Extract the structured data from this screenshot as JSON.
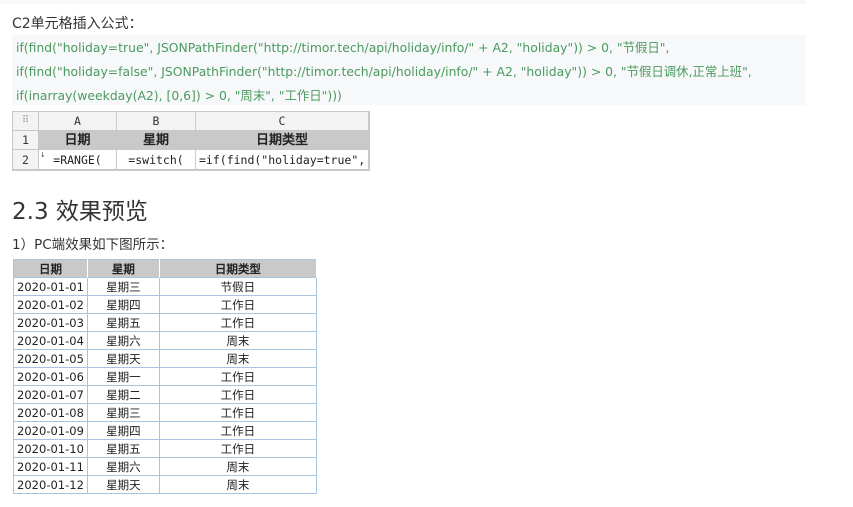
{
  "intro_text": "C2单元格插入公式：",
  "code_lines": [
    "if(find(\"holiday=true\", JSONPathFinder(\"http://timor.tech/api/holiday/info/\" + A2, \"holiday\")) > 0, \"节假日\",",
    "if(find(\"holiday=false\", JSONPathFinder(\"http://timor.tech/api/holiday/info/\" + A2, \"holiday\")) > 0, \"节假日调休,正常上班\",",
    "if(inarray(weekday(A2), [0,6]) > 0, \"周末\", \"工作日\")))"
  ],
  "designer": {
    "corner_icon": "grid-handle-icon",
    "columns": [
      "A",
      "B",
      "C"
    ],
    "rows": [
      {
        "num": "1",
        "cells": [
          "日期",
          "星期",
          "日期类型"
        ]
      },
      {
        "num": "2",
        "cells": [
          "=RANGE(",
          "=switch(",
          "=if(find(\"holiday=true\","
        ]
      }
    ]
  },
  "section_heading": "2.3 效果预览",
  "section_sub": "1）PC端效果如下图所示：",
  "result_table": {
    "headers": [
      "日期",
      "星期",
      "日期类型"
    ],
    "rows": [
      [
        "2020-01-01",
        "星期三",
        "节假日"
      ],
      [
        "2020-01-02",
        "星期四",
        "工作日"
      ],
      [
        "2020-01-03",
        "星期五",
        "工作日"
      ],
      [
        "2020-01-04",
        "星期六",
        "周末"
      ],
      [
        "2020-01-05",
        "星期天",
        "周末"
      ],
      [
        "2020-01-06",
        "星期一",
        "工作日"
      ],
      [
        "2020-01-07",
        "星期二",
        "工作日"
      ],
      [
        "2020-01-08",
        "星期三",
        "工作日"
      ],
      [
        "2020-01-09",
        "星期四",
        "工作日"
      ],
      [
        "2020-01-10",
        "星期五",
        "工作日"
      ],
      [
        "2020-01-11",
        "星期六",
        "周末"
      ],
      [
        "2020-01-12",
        "星期天",
        "周末"
      ]
    ]
  }
}
